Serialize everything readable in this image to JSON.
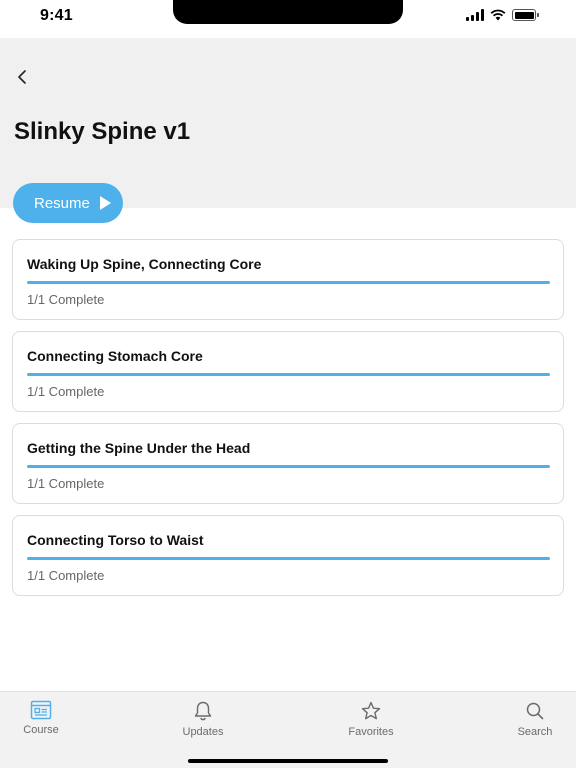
{
  "status_bar": {
    "time": "9:41"
  },
  "header": {
    "back_icon": "chevron-left-icon",
    "title": "Slinky Spine v1"
  },
  "resume": {
    "label": "Resume",
    "icon": "play-icon"
  },
  "lessons": [
    {
      "title": "Waking Up Spine, Connecting Core",
      "status": "1/1 Complete",
      "progress": 1.0
    },
    {
      "title": "Connecting Stomach Core",
      "status": "1/1 Complete",
      "progress": 1.0
    },
    {
      "title": "Getting the Spine Under the Head",
      "status": "1/1 Complete",
      "progress": 1.0
    },
    {
      "title": "Connecting Torso to Waist",
      "status": "1/1 Complete",
      "progress": 1.0
    }
  ],
  "tab_bar": {
    "tabs": [
      {
        "label": "Course",
        "icon": "course-icon",
        "active": true
      },
      {
        "label": "Updates",
        "icon": "bell-icon",
        "active": false
      },
      {
        "label": "Favorites",
        "icon": "star-icon",
        "active": false
      },
      {
        "label": "Search",
        "icon": "search-icon",
        "active": false
      }
    ]
  },
  "colors": {
    "accent": "#4fb1ec",
    "header_bg": "#f0f0f0",
    "tab_bar_bg": "#f2f2f2"
  }
}
